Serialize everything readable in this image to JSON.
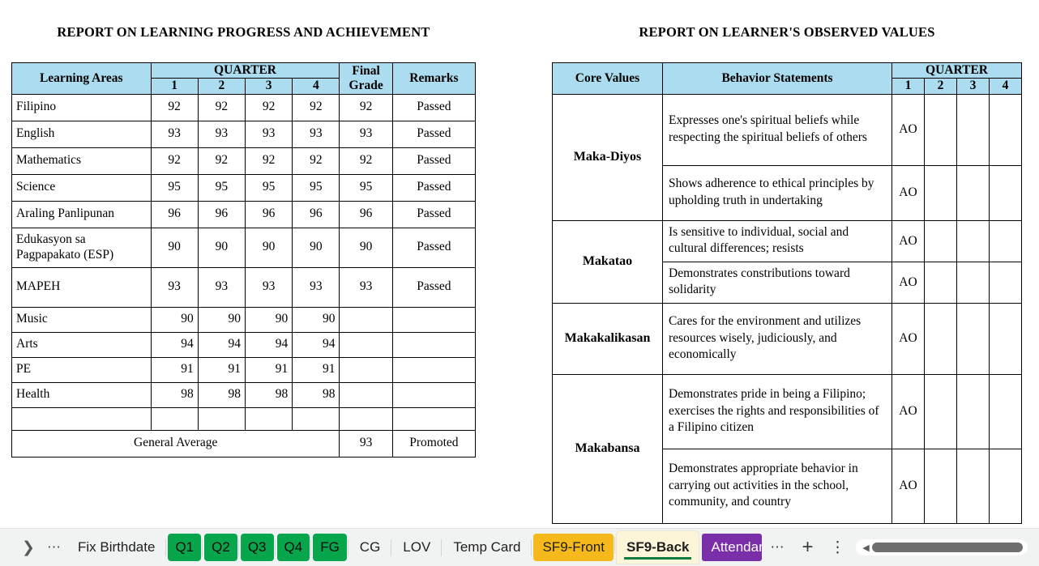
{
  "left_report": {
    "title": "REPORT ON LEARNING PROGRESS AND ACHIEVEMENT",
    "headers": {
      "learning_areas": "Learning Areas",
      "quarter": "QUARTER",
      "q1": "1",
      "q2": "2",
      "q3": "3",
      "q4": "4",
      "final_grade": "Final Grade",
      "final_grade_line1": "Final",
      "final_grade_line2": "Grade",
      "remarks": "Remarks"
    },
    "rows": [
      {
        "area": "Filipino",
        "q1": "92",
        "q2": "92",
        "q3": "92",
        "q4": "92",
        "final": "92",
        "remarks": "Passed"
      },
      {
        "area": "English",
        "q1": "93",
        "q2": "93",
        "q3": "93",
        "q4": "93",
        "final": "93",
        "remarks": "Passed"
      },
      {
        "area": "Mathematics",
        "q1": "92",
        "q2": "92",
        "q3": "92",
        "q4": "92",
        "final": "92",
        "remarks": "Passed"
      },
      {
        "area": "Science",
        "q1": "95",
        "q2": "95",
        "q3": "95",
        "q4": "95",
        "final": "95",
        "remarks": "Passed"
      },
      {
        "area": "Araling Panlipunan",
        "q1": "96",
        "q2": "96",
        "q3": "96",
        "q4": "96",
        "final": "96",
        "remarks": "Passed"
      },
      {
        "area": "Edukasyon sa Pagpapakato (ESP)",
        "q1": "90",
        "q2": "90",
        "q3": "90",
        "q4": "90",
        "final": "90",
        "remarks": "Passed"
      },
      {
        "area": "MAPEH",
        "q1": "93",
        "q2": "93",
        "q3": "93",
        "q4": "93",
        "final": "93",
        "remarks": "Passed"
      }
    ],
    "subrows": [
      {
        "area": "Music",
        "q1": "90",
        "q2": "90",
        "q3": "90",
        "q4": "90",
        "final": "",
        "remarks": ""
      },
      {
        "area": "Arts",
        "q1": "94",
        "q2": "94",
        "q3": "94",
        "q4": "94",
        "final": "",
        "remarks": ""
      },
      {
        "area": "PE",
        "q1": "91",
        "q2": "91",
        "q3": "91",
        "q4": "91",
        "final": "",
        "remarks": ""
      },
      {
        "area": "Health",
        "q1": "98",
        "q2": "98",
        "q3": "98",
        "q4": "98",
        "final": "",
        "remarks": ""
      }
    ],
    "blank_row": {
      "area": "",
      "q1": "",
      "q2": "",
      "q3": "",
      "q4": "",
      "final": "",
      "remarks": ""
    },
    "summary": {
      "label": "General Average",
      "final": "93",
      "remarks": "Promoted"
    }
  },
  "right_report": {
    "title": "REPORT ON LEARNER'S OBSERVED VALUES",
    "headers": {
      "core_values": "Core Values",
      "behavior_statements": "Behavior Statements",
      "quarter": "QUARTER",
      "q1": "1",
      "q2": "2",
      "q3": "3",
      "q4": "4"
    },
    "groups": [
      {
        "core_value": "Maka-Diyos",
        "statements": [
          {
            "text": "Expresses one's spiritual beliefs while respecting the spiritual beliefs of others",
            "q1": "AO",
            "q2": "",
            "q3": "",
            "q4": ""
          },
          {
            "text": "Shows adherence to ethical principles by upholding truth in undertaking",
            "q1": "AO",
            "q2": "",
            "q3": "",
            "q4": ""
          }
        ]
      },
      {
        "core_value": "Makatao",
        "statements": [
          {
            "text": "Is sensitive to individual, social and cultural differences; resists",
            "q1": "AO",
            "q2": "",
            "q3": "",
            "q4": ""
          },
          {
            "text": "Demonstrates constributions toward solidarity",
            "q1": "AO",
            "q2": "",
            "q3": "",
            "q4": ""
          }
        ]
      },
      {
        "core_value": "Makakalikasan",
        "statements": [
          {
            "text": "Cares for the environment and utilizes resources wisely, judiciously, and economically",
            "q1": "AO",
            "q2": "",
            "q3": "",
            "q4": ""
          }
        ]
      },
      {
        "core_value": "Makabansa",
        "statements": [
          {
            "text": "Demonstrates pride in being a Filipino; exercises the rights and responsibilities of a Filipino citizen",
            "q1": "AO",
            "q2": "",
            "q3": "",
            "q4": ""
          },
          {
            "text": "Demonstrates appropriate behavior in carrying out activities in the school, community, and country",
            "q1": "AO",
            "q2": "",
            "q3": "",
            "q4": ""
          }
        ]
      }
    ]
  },
  "tabbar": {
    "nav_next_icon": "chevron-right-icon",
    "sheet_list_icon": "ellipsis-icon",
    "tab_overflow_icon": "ellipsis-icon",
    "add_sheet_icon": "plus-icon",
    "more_options_icon": "vertical-ellipsis-icon",
    "scroll_left_icon": "triangle-left-icon",
    "tabs": [
      {
        "label": "Fix Birthdate",
        "style": "plain",
        "active": false
      },
      {
        "label": "Q1",
        "style": "green",
        "active": false
      },
      {
        "label": "Q2",
        "style": "green",
        "active": false
      },
      {
        "label": "Q3",
        "style": "green",
        "active": false
      },
      {
        "label": "Q4",
        "style": "green",
        "active": false
      },
      {
        "label": "FG",
        "style": "green",
        "active": false
      },
      {
        "label": "CG",
        "style": "plain",
        "active": false
      },
      {
        "label": "LOV",
        "style": "plain",
        "active": false
      },
      {
        "label": "Temp Card",
        "style": "plain",
        "active": false
      },
      {
        "label": "SF9-Front",
        "style": "amber",
        "active": false
      },
      {
        "label": "SF9-Back",
        "style": "active",
        "active": true
      },
      {
        "label": "Attendance",
        "style": "purple",
        "active": false
      }
    ]
  },
  "colors": {
    "header_blue": "#ACDCEF",
    "tab_green": "#07a64c",
    "tab_amber": "#f5b91b",
    "tab_purple": "#7a2ea8",
    "active_tab_bg": "#fdf5d8",
    "active_tab_underline": "#107c41",
    "tabbar_bg": "#f1f3f2",
    "grid_line": "#000000",
    "page_bg": "#ffffff"
  }
}
